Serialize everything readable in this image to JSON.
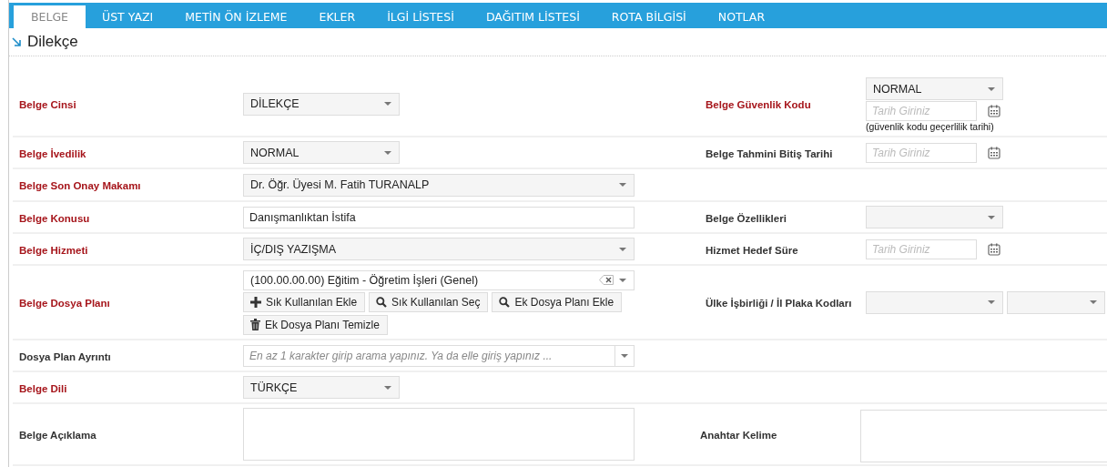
{
  "tabs": [
    {
      "label": "BELGE",
      "selected": true
    },
    {
      "label": "ÜST YAZI",
      "selected": false
    },
    {
      "label": "METİN ÖN İZLEME",
      "selected": false
    },
    {
      "label": "EKLER",
      "selected": false
    },
    {
      "label": "İLGİ LİSTESİ",
      "selected": false
    },
    {
      "label": "DAĞITIM LİSTESİ",
      "selected": false
    },
    {
      "label": "ROTA BİLGİSİ",
      "selected": false
    },
    {
      "label": "NOTLAR",
      "selected": false
    }
  ],
  "heading": "Dilekçe",
  "rows": [
    {
      "left": {
        "label": "Belge Cinsi",
        "required": true,
        "field": {
          "kind": "select",
          "value": "DİLEKÇE"
        }
      },
      "right": {
        "label": "Belge Güvenlik Kodu",
        "required": true,
        "field": {
          "kind": "security",
          "value": "NORMAL",
          "placeholder": "Tarih Giriniz",
          "note": "(güvenlik kodu geçerlilik tarihi)"
        }
      }
    },
    {
      "left": {
        "label": "Belge İvedilik",
        "required": true,
        "field": {
          "kind": "select",
          "value": "NORMAL"
        }
      },
      "right": {
        "label": "Belge Tahmini Bitiş Tarihi",
        "required": false,
        "field": {
          "kind": "date",
          "placeholder": "Tarih Giriniz"
        }
      }
    },
    {
      "left": {
        "label": "Belge Son Onay Makamı",
        "required": true,
        "field": {
          "kind": "wide-select",
          "value": "Dr. Öğr. Üyesi M. Fatih TURANALP"
        }
      }
    },
    {
      "left": {
        "label": "Belge Konusu",
        "required": true,
        "field": {
          "kind": "text",
          "value": "Danışmanlıktan İstifa"
        }
      },
      "right": {
        "label": "Belge Özellikleri",
        "required": false,
        "field": {
          "kind": "select"
        }
      }
    },
    {
      "left": {
        "label": "Belge Hizmeti",
        "required": true,
        "field": {
          "kind": "wide-select",
          "value": "İÇ/DIŞ YAZIŞMA"
        }
      },
      "right": {
        "label": "Hizmet Hedef Süre",
        "required": false,
        "field": {
          "kind": "date",
          "placeholder": "Tarih Giriniz"
        }
      }
    },
    {
      "left": {
        "label": "Belge Dosya Planı",
        "required": true,
        "field": {
          "kind": "plan",
          "value": "(100.00.00.00) Eğitim - Öğretim İşleri (Genel)",
          "buttons": [
            {
              "kind": "plus",
              "label": "Sık Kullanılan Ekle"
            },
            {
              "kind": "search",
              "label": "Sık Kullanılan Seç"
            },
            {
              "kind": "search",
              "label": "Ek Dosya Planı Ekle"
            },
            {
              "kind": "trash",
              "label": "Ek Dosya Planı Temizle"
            }
          ]
        }
      },
      "right": {
        "label": "Ülke İşbirliği / İl Plaka Kodları",
        "required": false,
        "field": {
          "kind": "select-pair"
        }
      }
    },
    {
      "left": {
        "label": "Dosya Plan Ayrıntı",
        "required": false,
        "field": {
          "kind": "search-combo",
          "placeholder": "En az 1 karakter girip arama yapınız. Ya da elle giriş yapınız ..."
        }
      }
    },
    {
      "left": {
        "label": "Belge Dili",
        "required": true,
        "field": {
          "kind": "select",
          "value": "TÜRKÇE"
        }
      }
    },
    {
      "left": {
        "label": "Belge Açıklama",
        "required": false,
        "field": {
          "kind": "textarea"
        }
      },
      "right": {
        "label": "Anahtar Kelime",
        "required": false,
        "field": {
          "kind": "textarea"
        }
      }
    }
  ]
}
